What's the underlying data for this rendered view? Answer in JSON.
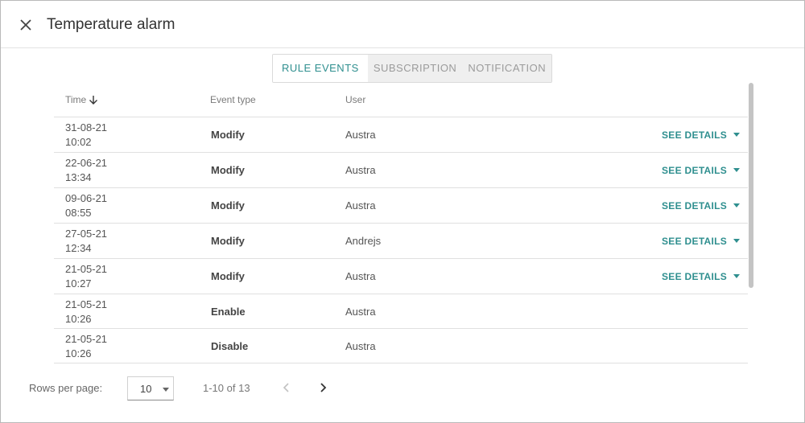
{
  "dialog": {
    "title": "Temperature alarm"
  },
  "tabs": [
    {
      "label": "RULE EVENTS",
      "active": true
    },
    {
      "label": "SUBSCRIPTION",
      "active": false
    },
    {
      "label": "NOTIFICATION",
      "active": false
    }
  ],
  "table": {
    "columns": {
      "time": "Time",
      "event_type": "Event type",
      "user": "User"
    },
    "sort_icon": "arrow-down-icon",
    "details_label": "SEE DETAILS",
    "rows": [
      {
        "date": "31-08-21",
        "time": "10:02",
        "event_type": "Modify",
        "user": "Austra",
        "has_details": true
      },
      {
        "date": "22-06-21",
        "time": "13:34",
        "event_type": "Modify",
        "user": "Austra",
        "has_details": true
      },
      {
        "date": "09-06-21",
        "time": "08:55",
        "event_type": "Modify",
        "user": "Austra",
        "has_details": true
      },
      {
        "date": "27-05-21",
        "time": "12:34",
        "event_type": "Modify",
        "user": "Andrejs",
        "has_details": true
      },
      {
        "date": "21-05-21",
        "time": "10:27",
        "event_type": "Modify",
        "user": "Austra",
        "has_details": true
      },
      {
        "date": "21-05-21",
        "time": "10:26",
        "event_type": "Enable",
        "user": "Austra",
        "has_details": false
      },
      {
        "date": "21-05-21",
        "time": "10:26",
        "event_type": "Disable",
        "user": "Austra",
        "has_details": false
      }
    ]
  },
  "pagination": {
    "rows_per_page_label": "Rows per page:",
    "rows_per_page_value": "10",
    "range_text": "1-10 of 13"
  },
  "colors": {
    "accent": "#2f8f8f",
    "inactive_tab_bg": "#efefef",
    "inactive_tab_text": "#9b9b9b"
  }
}
